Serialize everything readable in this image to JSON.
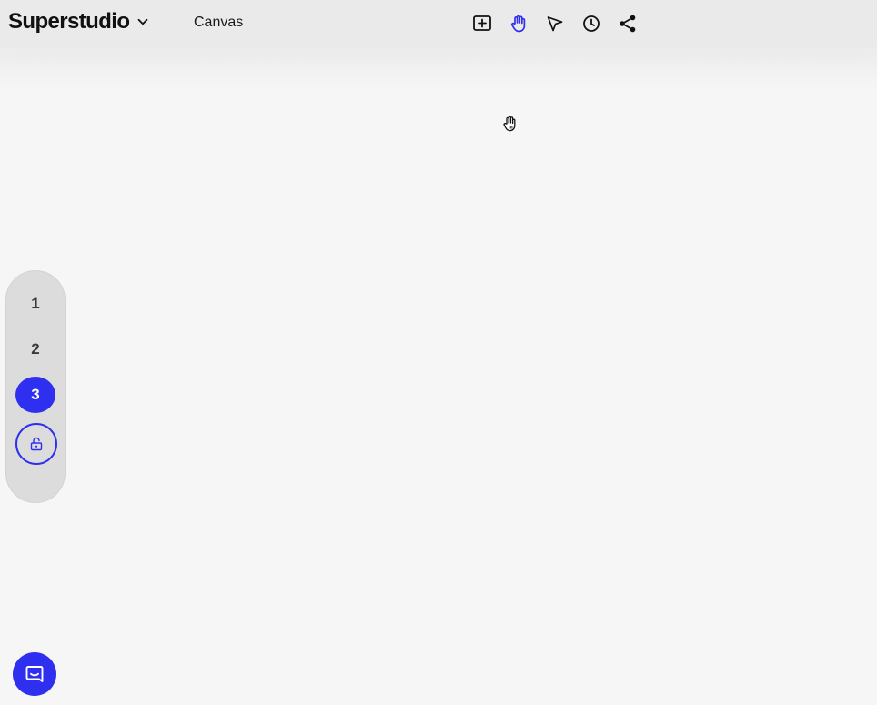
{
  "header": {
    "brand_name": "Superstudio",
    "project_name": "Canvas"
  },
  "toolbar": {
    "tools": [
      {
        "name": "add-frame",
        "icon": "plus-square-icon",
        "active": false
      },
      {
        "name": "hand",
        "icon": "hand-icon",
        "active": true
      },
      {
        "name": "select",
        "icon": "pointer-icon",
        "active": false
      },
      {
        "name": "history",
        "icon": "clock-icon",
        "active": false
      },
      {
        "name": "share",
        "icon": "share-icon",
        "active": false
      }
    ]
  },
  "pages": {
    "items": [
      "1",
      "2",
      "3"
    ],
    "active": "3",
    "lock_icon": "unlock-icon"
  },
  "chat": {
    "icon": "chat-icon"
  },
  "colors": {
    "accent": "#2f2ff0",
    "header_bg": "#eaeaea",
    "canvas_bg": "#f6f6f6",
    "pill_bg": "#dcdcdc"
  }
}
